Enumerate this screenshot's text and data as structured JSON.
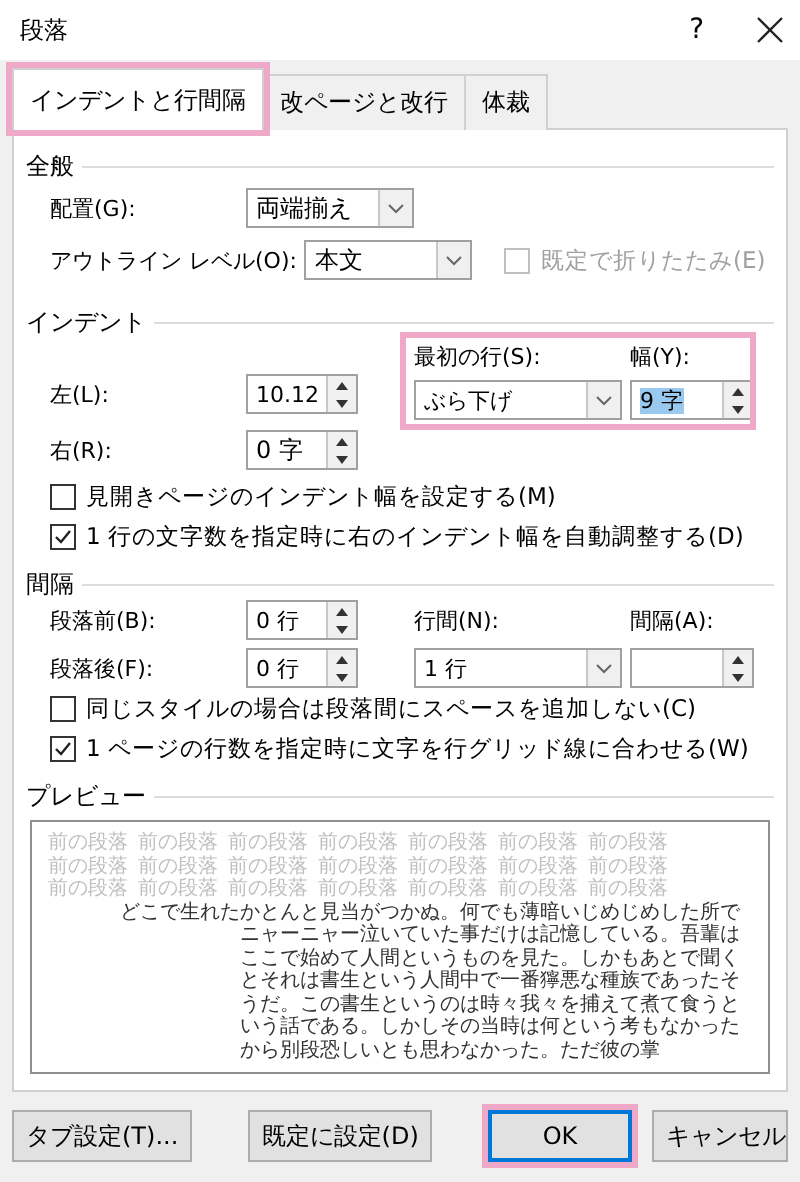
{
  "window": {
    "title": "段落",
    "help": "?"
  },
  "tabs": [
    {
      "label": "インデントと行間隔",
      "selected": true,
      "highlighted": true
    },
    {
      "label": "改ページと改行",
      "selected": false,
      "highlighted": false
    },
    {
      "label": "体裁",
      "selected": false,
      "highlighted": false
    }
  ],
  "general": {
    "heading": "全般",
    "alignment": {
      "label": "配置(G):",
      "value": "両端揃え"
    },
    "outline_level": {
      "label": "アウトライン レベル(O):",
      "value": "本文"
    },
    "collapse": {
      "label": "既定で折りたたみ(E)",
      "checked": false,
      "disabled": true
    }
  },
  "indent": {
    "heading": "インデント",
    "left": {
      "label": "左(L):",
      "value": "10.12"
    },
    "right": {
      "label": "右(R):",
      "value": "0 字"
    },
    "first_line": {
      "label": "最初の行(S):",
      "value": "ぶら下げ"
    },
    "by": {
      "label": "幅(Y):",
      "value": "9 字",
      "value_selected": true
    },
    "first_line_highlighted": true,
    "checks": [
      {
        "label": "見開きページのインデント幅を設定する(M)",
        "checked": false
      },
      {
        "label": "1 行の文字数を指定時に右のインデント幅を自動調整する(D)",
        "checked": true
      }
    ]
  },
  "spacing": {
    "heading": "間隔",
    "before": {
      "label": "段落前(B):",
      "value": "0 行"
    },
    "after": {
      "label": "段落後(F):",
      "value": "0 行"
    },
    "line_spacing": {
      "label": "行間(N):",
      "value": "1 行"
    },
    "at": {
      "label": "間隔(A):"
    },
    "checks": [
      {
        "label": "同じスタイルの場合は段落間にスペースを追加しない(C)",
        "checked": false
      },
      {
        "label": "1 ページの行数を指定時に文字を行グリッド線に合わせる(W)",
        "checked": true
      }
    ]
  },
  "preview": {
    "heading": "プレビュー",
    "previous_paragraph": [
      "前の段落",
      "前の段落",
      "前の段落",
      "前の段落",
      "前の段落",
      "前の段落",
      "前の段落",
      "前の段落",
      "前の段落",
      "前の段落",
      "前の段落",
      "前の段落",
      "前の段落",
      "前の段落",
      "前の段落",
      "前の段落",
      "前の段落",
      "前の段落",
      "前の段落",
      "前の段落",
      "前の段落"
    ],
    "paragraph": "どこで生れたかとんと見当がつかぬ。何でも薄暗いじめじめした所でニャーニャー泣いていた事だけは記憶している。吾輩はここで始めて人間というものを見た。しかもあとで聞くとそれは書生という人間中で一番獰悪な種族であったそうだ。この書生というのは時々我々を捕えて煮て食うという話である。しかしその当時は何という考もなかったから別段恐しいとも思わなかった。ただ彼の掌"
  },
  "buttons": [
    {
      "label": "タブ設定(T)...",
      "default": false,
      "highlighted": false
    },
    {
      "label": "既定に設定(D)",
      "default": false,
      "highlighted": false
    },
    {
      "label": "OK",
      "default": true,
      "highlighted": true
    },
    {
      "label": "キャンセル",
      "default": false,
      "highlighted": false
    }
  ]
}
